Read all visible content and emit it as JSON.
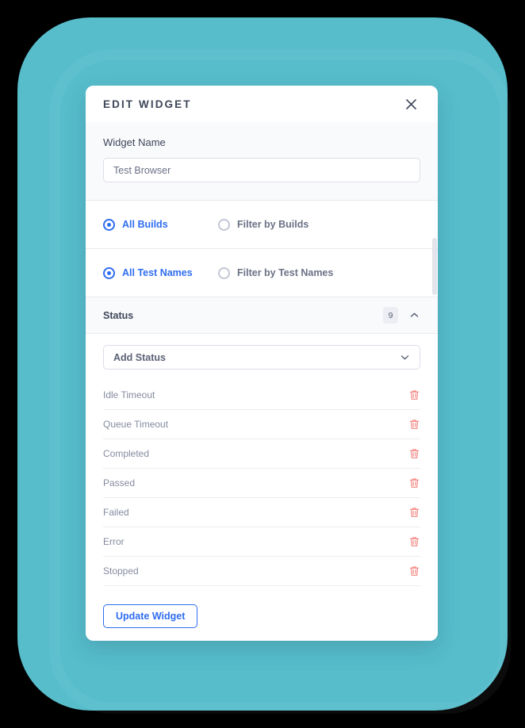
{
  "theme": {
    "backdrop_color": "#57bdcb",
    "accent_blue": "#2f6df0",
    "danger_red": "#f2837f",
    "title_color": "#3d4659"
  },
  "dialog": {
    "title": "EDIT WIDGET",
    "close_icon": "close-icon"
  },
  "widget_name": {
    "label": "Widget Name",
    "value": "Test Browser",
    "placeholder": "Widget Name"
  },
  "builds_row": {
    "options": [
      {
        "label": "All Builds",
        "selected": true
      },
      {
        "label": "Filter by Builds",
        "selected": false
      }
    ]
  },
  "test_names_row": {
    "options": [
      {
        "label": "All Test Names",
        "selected": true
      },
      {
        "label": "Filter by Test Names",
        "selected": false
      }
    ]
  },
  "status_section": {
    "title": "Status",
    "count": "9",
    "collapse_icon": "chevron-up-icon",
    "select": {
      "value": "Add Status",
      "placeholder": "Add Status",
      "chevron_icon": "chevron-down-icon"
    },
    "items": [
      {
        "label": "Idle Timeout",
        "delete_icon": "trash-icon"
      },
      {
        "label": "Queue Timeout",
        "delete_icon": "trash-icon"
      },
      {
        "label": "Completed",
        "delete_icon": "trash-icon"
      },
      {
        "label": "Passed",
        "delete_icon": "trash-icon"
      },
      {
        "label": "Failed",
        "delete_icon": "trash-icon"
      },
      {
        "label": "Error",
        "delete_icon": "trash-icon"
      },
      {
        "label": "Stopped",
        "delete_icon": "trash-icon"
      },
      {
        "label": "",
        "delete_icon": "trash-icon"
      }
    ]
  },
  "footer": {
    "primary_label": "Update Widget"
  }
}
